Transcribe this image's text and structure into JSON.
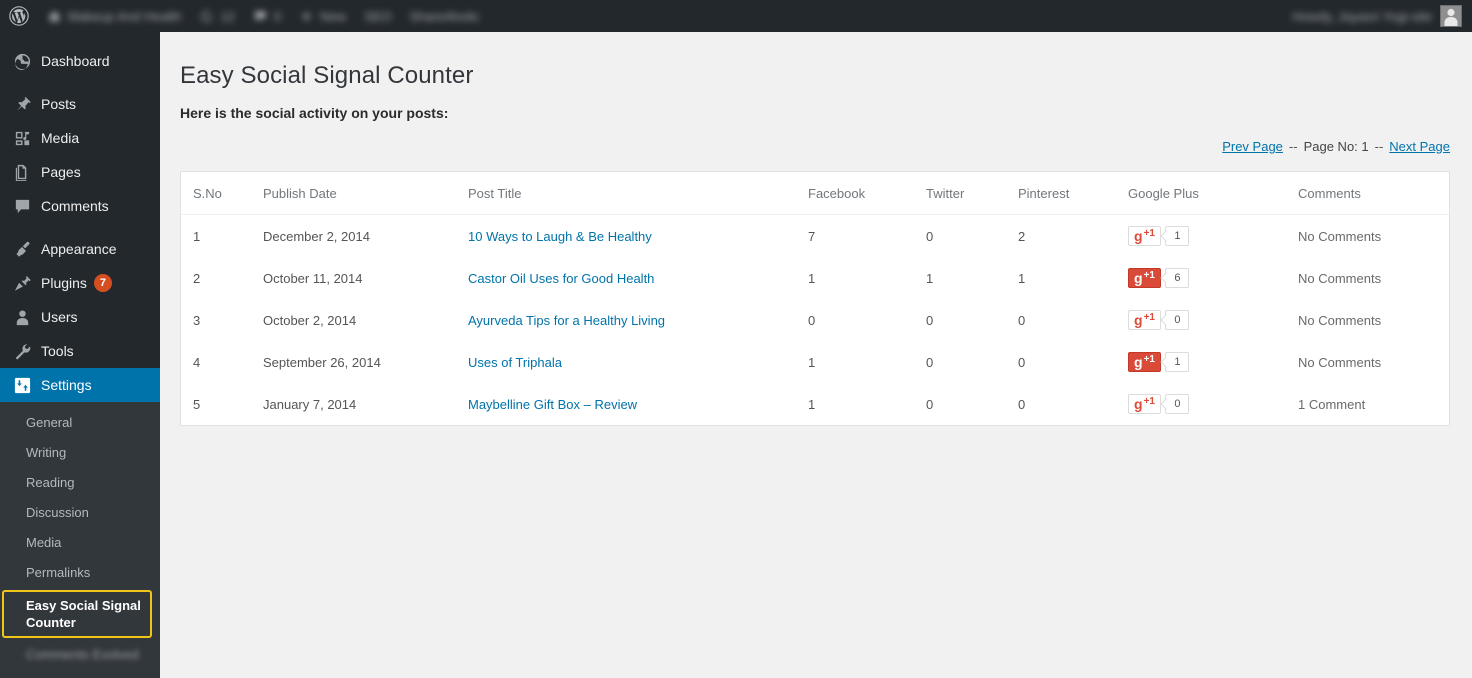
{
  "adminbar": {
    "wp_logo": "wordpress-logo-icon",
    "site_name": "Makeup And Health",
    "updates_count": "12",
    "comments_count": "0",
    "new_label": "New",
    "seo_label": "SEO",
    "sharetools_label": "ShareAholic",
    "howdy": "Howdy, Jayasri Yogi-site"
  },
  "sidebar": {
    "items": [
      {
        "label": "Dashboard",
        "icon": "dashboard-icon"
      },
      {
        "label": "Posts",
        "icon": "pin-icon"
      },
      {
        "label": "Media",
        "icon": "media-icon"
      },
      {
        "label": "Pages",
        "icon": "pages-icon"
      },
      {
        "label": "Comments",
        "icon": "comment-bubble-icon"
      },
      {
        "label": "Appearance",
        "icon": "paintbrush-icon"
      },
      {
        "label": "Plugins",
        "icon": "plug-icon",
        "badge": "7"
      },
      {
        "label": "Users",
        "icon": "user-icon"
      },
      {
        "label": "Tools",
        "icon": "wrench-icon"
      },
      {
        "label": "Settings",
        "icon": "settings-sliders-icon",
        "current": true
      }
    ],
    "submenu": [
      {
        "label": "General"
      },
      {
        "label": "Writing"
      },
      {
        "label": "Reading"
      },
      {
        "label": "Discussion"
      },
      {
        "label": "Media"
      },
      {
        "label": "Permalinks"
      },
      {
        "label": "Easy Social Signal Counter",
        "selected": true
      },
      {
        "label": "Comments Evolved",
        "blurred": true
      }
    ]
  },
  "main": {
    "page_title": "Easy Social Signal Counter",
    "intro": "Here is the social activity on your posts:",
    "pagination": {
      "prev": "Prev Page",
      "sep_left": "--",
      "page_no": "Page No: 1",
      "sep_right": "--",
      "next": "Next Page"
    },
    "table": {
      "headers": [
        "S.No",
        "Publish Date",
        "Post Title",
        "Facebook",
        "Twitter",
        "Pinterest",
        "Google Plus",
        "Comments"
      ],
      "rows": [
        {
          "sno": "1",
          "date": "December 2, 2014",
          "title": "10 Ways to Laugh & Be Healthy",
          "facebook": "7",
          "twitter": "0",
          "pinterest": "2",
          "gplus_count": "1",
          "gplus_filled": false,
          "comments": "No Comments"
        },
        {
          "sno": "2",
          "date": "October 11, 2014",
          "title": "Castor Oil Uses for Good Health",
          "facebook": "1",
          "twitter": "1",
          "pinterest": "1",
          "gplus_count": "6",
          "gplus_filled": true,
          "comments": "No Comments"
        },
        {
          "sno": "3",
          "date": "October 2, 2014",
          "title": "Ayurveda Tips for a Healthy Living",
          "facebook": "0",
          "twitter": "0",
          "pinterest": "0",
          "gplus_count": "0",
          "gplus_filled": false,
          "comments": "No Comments"
        },
        {
          "sno": "4",
          "date": "September 26, 2014",
          "title": "Uses of Triphala",
          "facebook": "1",
          "twitter": "0",
          "pinterest": "0",
          "gplus_count": "1",
          "gplus_filled": true,
          "comments": "No Comments"
        },
        {
          "sno": "5",
          "date": "January 7, 2014",
          "title": "Maybelline Gift Box – Review",
          "facebook": "1",
          "twitter": "0",
          "pinterest": "0",
          "gplus_count": "0",
          "gplus_filled": false,
          "comments": "1 Comment"
        }
      ]
    },
    "gplus_badge": {
      "g_letter": "g",
      "plus_one": "+1"
    }
  },
  "colors": {
    "admin_bar": "#23282d",
    "sidebar": "#23282d",
    "submenu": "#32373c",
    "current_menu": "#0073aa",
    "link": "#0073aa",
    "highlight_border": "#f0c419",
    "gplus_red": "#d94a38",
    "badge_orange": "#d54e21"
  }
}
